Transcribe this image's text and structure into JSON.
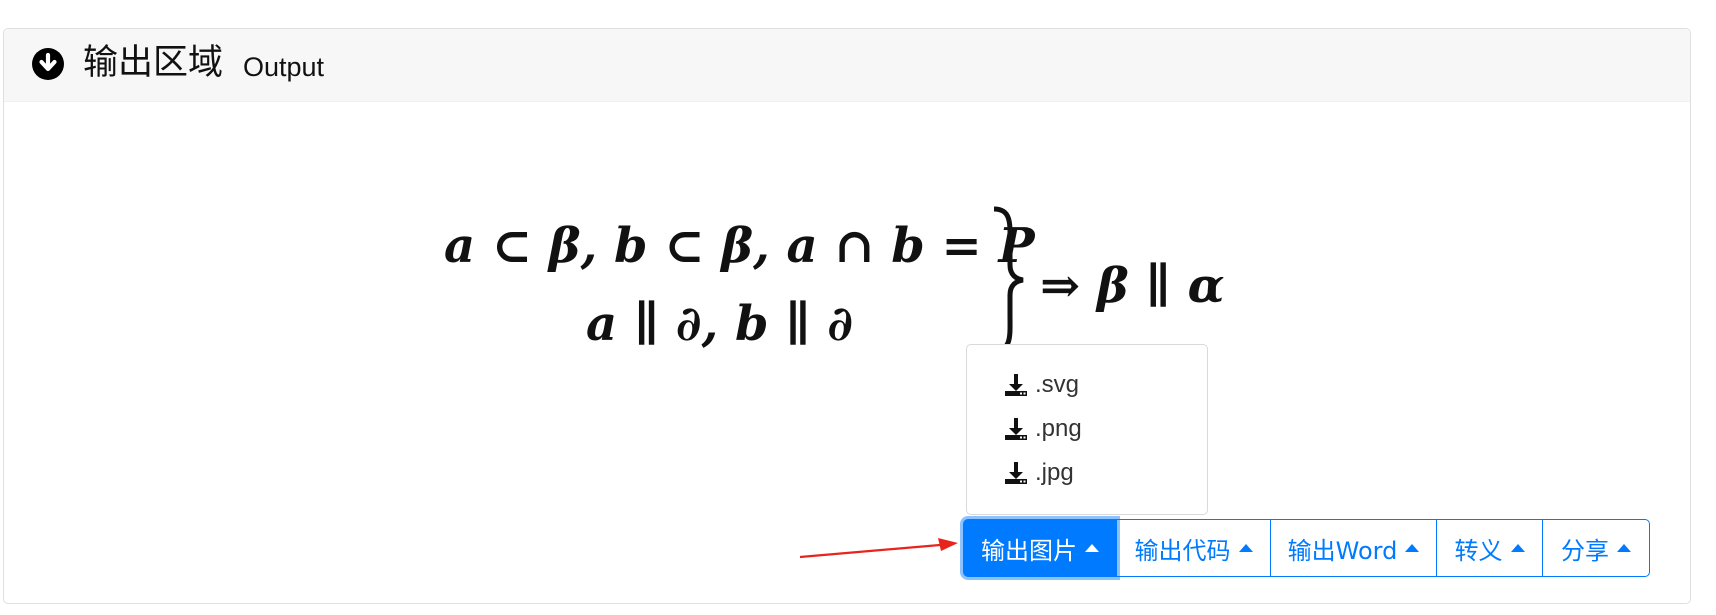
{
  "header": {
    "title": "输出区域",
    "subtitle": "Output",
    "icon": "arrow-circle-down-icon"
  },
  "formula": {
    "line1": "a ⊂ β, b ⊂ β, a ∩ b = P",
    "line2": "a ∥ ∂, b ∥ ∂",
    "result": "⇒ β ∥ α"
  },
  "dropdown": {
    "items": [
      {
        "label": ".svg",
        "icon": "download-icon"
      },
      {
        "label": ".png",
        "icon": "download-icon"
      },
      {
        "label": ".jpg",
        "icon": "download-icon"
      }
    ]
  },
  "buttons": [
    {
      "label": "输出图片",
      "active": true
    },
    {
      "label": "输出代码",
      "active": false
    },
    {
      "label": "输出Word",
      "active": false
    },
    {
      "label": "转义",
      "active": false
    },
    {
      "label": "分享",
      "active": false
    }
  ],
  "colors": {
    "accent": "#007bff",
    "annotation_arrow": "#e8241c"
  }
}
